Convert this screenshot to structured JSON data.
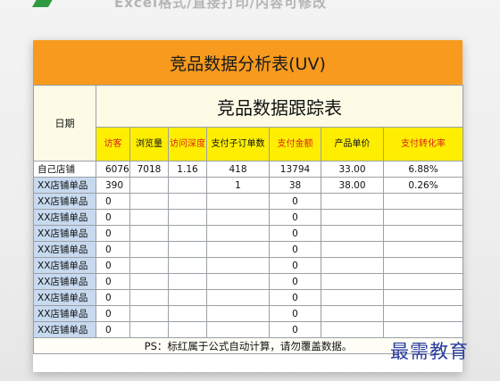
{
  "caption": "Excel格式/直接打印/内容可修改",
  "title": "竞品数据分析表(UV)",
  "subtitle": "竞品数据跟踪表",
  "date_label": "日期",
  "columns": [
    "访客",
    "浏览量",
    "访问深度",
    "支付子订单数",
    "支付金额",
    "产品单价",
    "支付转化率"
  ],
  "rows": [
    {
      "label": "自己店铺",
      "cells": [
        "6076",
        "7018",
        "1.16",
        "418",
        "13794",
        "33.00",
        "6.88%"
      ]
    },
    {
      "label": "XX店铺单品",
      "cells": [
        "390",
        "",
        "",
        "1",
        "38",
        "38.00",
        "0.26%"
      ]
    },
    {
      "label": "XX店铺单品",
      "cells": [
        "0",
        "",
        "",
        "",
        "0",
        "",
        ""
      ]
    },
    {
      "label": "XX店铺单品",
      "cells": [
        "0",
        "",
        "",
        "",
        "0",
        "",
        ""
      ]
    },
    {
      "label": "XX店铺单品",
      "cells": [
        "0",
        "",
        "",
        "",
        "0",
        "",
        ""
      ]
    },
    {
      "label": "XX店铺单品",
      "cells": [
        "0",
        "",
        "",
        "",
        "0",
        "",
        ""
      ]
    },
    {
      "label": "XX店铺单品",
      "cells": [
        "0",
        "",
        "",
        "",
        "0",
        "",
        ""
      ]
    },
    {
      "label": "XX店铺单品",
      "cells": [
        "0",
        "",
        "",
        "",
        "0",
        "",
        ""
      ]
    },
    {
      "label": "XX店铺单品",
      "cells": [
        "0",
        "",
        "",
        "",
        "0",
        "",
        ""
      ]
    },
    {
      "label": "XX店铺单品",
      "cells": [
        "0",
        "",
        "",
        "",
        "0",
        "",
        ""
      ]
    },
    {
      "label": "XX店铺单品",
      "cells": [
        "0",
        "",
        "",
        "",
        "0",
        "",
        ""
      ]
    }
  ],
  "note": "PS：标红属于公式自动计算，请勿覆盖数据。",
  "watermark": "最需教育"
}
